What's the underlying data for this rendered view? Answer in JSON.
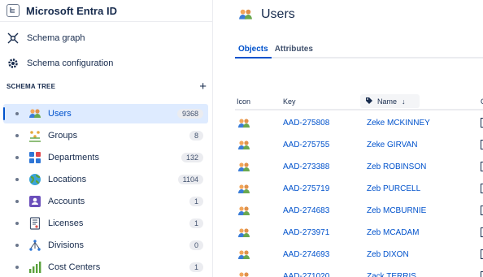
{
  "app": {
    "title": "Microsoft Entra ID"
  },
  "nav": {
    "schema_graph": "Schema graph",
    "schema_configuration": "Schema configuration"
  },
  "schema_tree": {
    "heading": "SCHEMA TREE",
    "add_label": "+",
    "items": [
      {
        "label": "Users",
        "count": "9368",
        "icon": "users-icon",
        "selected": true
      },
      {
        "label": "Groups",
        "count": "8",
        "icon": "groups-icon"
      },
      {
        "label": "Departments",
        "count": "132",
        "icon": "departments-icon"
      },
      {
        "label": "Locations",
        "count": "1104",
        "icon": "globe-icon"
      },
      {
        "label": "Accounts",
        "count": "1",
        "icon": "account-icon"
      },
      {
        "label": "Licenses",
        "count": "1",
        "icon": "license-icon"
      },
      {
        "label": "Divisions",
        "count": "0",
        "icon": "divisions-icon"
      },
      {
        "label": "Cost Centers",
        "count": "1",
        "icon": "chart-icon"
      }
    ]
  },
  "page": {
    "title": "Users"
  },
  "tabs": [
    {
      "label": "Objects",
      "active": true
    },
    {
      "label": "Attributes"
    }
  ],
  "table": {
    "headers": {
      "icon": "Icon",
      "key": "Key",
      "name": "Name",
      "next": "C"
    },
    "rows": [
      {
        "key": "AAD-275808",
        "name": "Zeke MCKINNEY"
      },
      {
        "key": "AAD-275755",
        "name": "Zeke GIRVAN"
      },
      {
        "key": "AAD-273388",
        "name": "Zeb ROBINSON"
      },
      {
        "key": "AAD-275719",
        "name": "Zeb PURCELL"
      },
      {
        "key": "AAD-274683",
        "name": "Zeb MCBURNIE"
      },
      {
        "key": "AAD-273971",
        "name": "Zeb MCADAM"
      },
      {
        "key": "AAD-274693",
        "name": "Zeb DIXON"
      },
      {
        "key": "AAD-271020",
        "name": "Zack TERRIS"
      }
    ]
  },
  "colors": {
    "accent": "#0052cc",
    "selected_bg": "#deebff"
  }
}
